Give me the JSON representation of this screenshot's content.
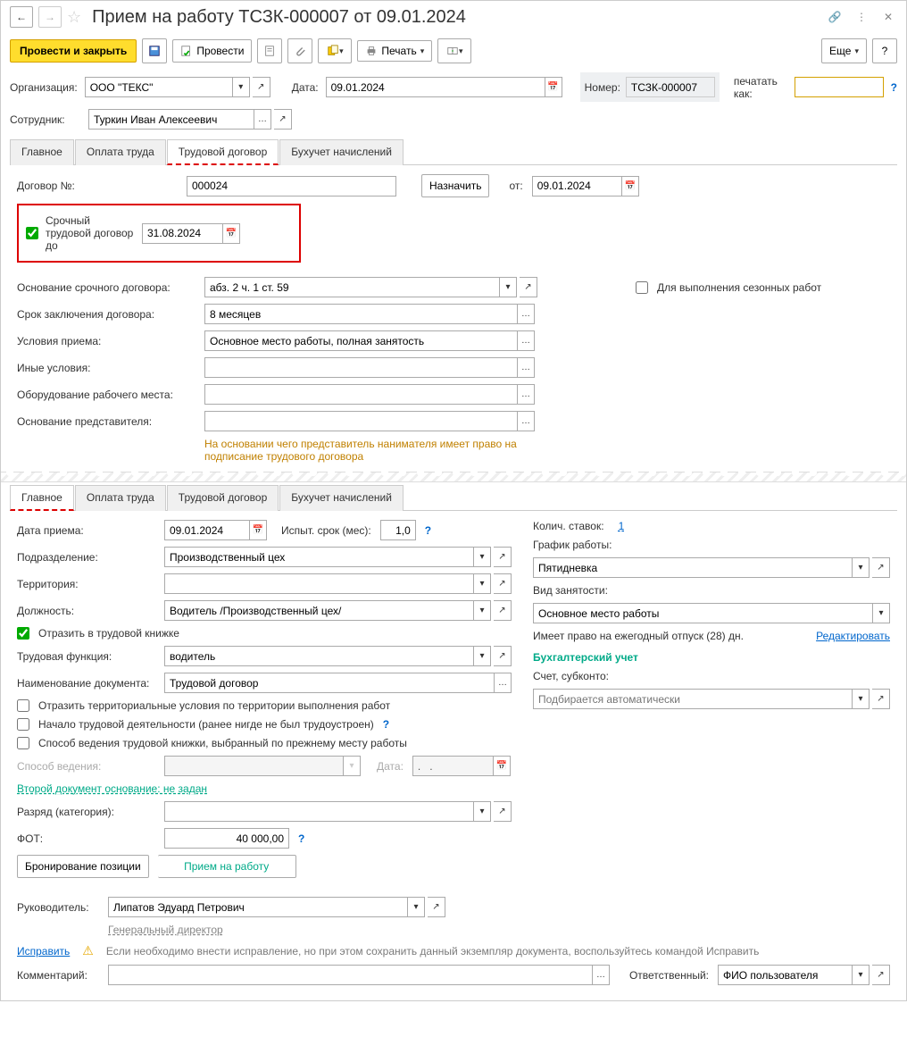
{
  "titlebar": {
    "title": "Прием на работу ТСЗК-000007 от 09.01.2024"
  },
  "toolbar": {
    "post_close": "Провести и закрыть",
    "post": "Провести",
    "print": "Печать",
    "more": "Еще"
  },
  "header": {
    "org_label": "Организация:",
    "org_value": "ООО \"ТЕКС\"",
    "date_label": "Дата:",
    "date_value": "09.01.2024",
    "number_label": "Номер:",
    "number_value": "ТСЗК-000007",
    "print_as_label": "печатать как:",
    "print_as_value": "",
    "employee_label": "Сотрудник:",
    "employee_value": "Туркин Иван Алексеевич"
  },
  "tabs1": {
    "main": "Главное",
    "pay": "Оплата труда",
    "contract": "Трудовой договор",
    "accounting": "Бухучет начислений"
  },
  "contract": {
    "num_label": "Договор №:",
    "num_value": "000024",
    "assign_btn": "Назначить",
    "from_label": "от:",
    "from_value": "09.01.2024",
    "urgent_check": "Срочный трудовой договор до",
    "urgent_date": "31.08.2024",
    "basis_label": "Основание срочного договора:",
    "basis_value": "абз. 2 ч. 1 ст. 59",
    "seasonal_check": "Для выполнения сезонных работ",
    "term_label": "Срок заключения договора:",
    "term_value": "8 месяцев",
    "conditions_label": "Условия приема:",
    "conditions_value": "Основное место работы, полная занятость",
    "other_conditions_label": "Иные условия:",
    "equipment_label": "Оборудование рабочего места:",
    "rep_basis_label": "Основание представителя:",
    "rep_hint": "На основании чего представитель нанимателя имеет право на подписание трудового договора"
  },
  "tabs2": {
    "main": "Главное",
    "pay": "Оплата труда",
    "contract": "Трудовой договор",
    "accounting": "Бухучет начислений"
  },
  "main": {
    "hire_date_label": "Дата приема:",
    "hire_date_value": "09.01.2024",
    "trial_label": "Испыт. срок (мес):",
    "trial_value": "1,0",
    "division_label": "Подразделение:",
    "division_value": "Производственный цех",
    "territory_label": "Территория:",
    "position_label": "Должность:",
    "position_value": "Водитель /Производственный цех/",
    "workbook_check": "Отразить в трудовой книжке",
    "func_label": "Трудовая функция:",
    "func_value": "водитель",
    "doc_name_label": "Наименование документа:",
    "doc_name_value": "Трудовой договор",
    "terr_cond_check": "Отразить территориальные условия по территории выполнения работ",
    "first_job_check": "Начало трудовой деятельности (ранее нигде не был трудоустроен)",
    "method_prev_check": "Способ ведения трудовой книжки, выбранный по прежнему месту работы",
    "method_label": "Способ ведения:",
    "method_date_label": "Дата:",
    "method_date_value": ".   .",
    "second_doc_link": "Второй документ основание: не задан",
    "rank_label": "Разряд (категория):",
    "fot_label": "ФОТ:",
    "fot_value": "40 000,00",
    "reserve_btn": "Бронирование позиции",
    "hire_btn": "Прием на работу",
    "rates_label": "Колич. ставок:",
    "rates_value": "1",
    "schedule_label": "График работы:",
    "schedule_value": "Пятидневка",
    "emptype_label": "Вид занятости:",
    "emptype_value": "Основное место работы",
    "vacation_text": "Имеет право на ежегодный отпуск (28) дн.",
    "edit_link": "Редактировать",
    "accounting_heading": "Бухгалтерский учет",
    "account_label": "Счет, субконто:",
    "account_placeholder": "Подбирается автоматически"
  },
  "footer": {
    "manager_label": "Руководитель:",
    "manager_value": "Липатов Эдуард Петрович",
    "manager_title": "Генеральный директор",
    "fix_link": "Исправить",
    "fix_hint": "Если необходимо внести исправление, но при этом сохранить данный экземпляр документа, воспользуйтесь командой Исправить",
    "comment_label": "Комментарий:",
    "responsible_label": "Ответственный:",
    "responsible_value": "ФИО пользователя"
  }
}
